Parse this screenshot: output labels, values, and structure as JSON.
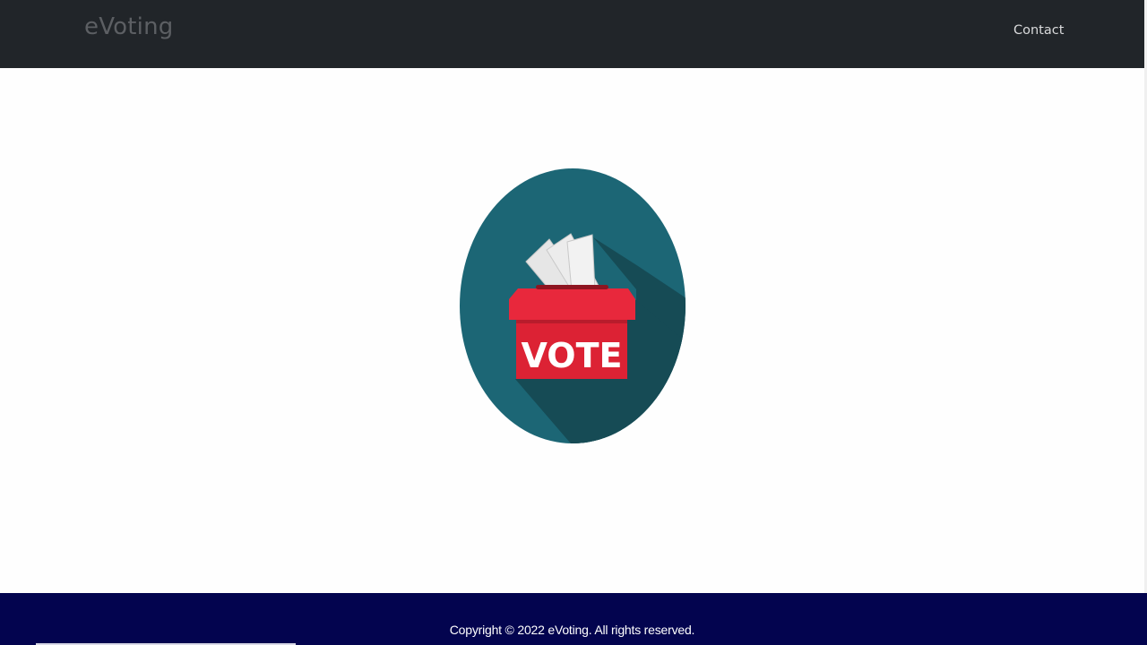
{
  "navbar": {
    "brand": "eVoting",
    "links": [
      {
        "label": "Contact"
      }
    ]
  },
  "hero": {
    "image_icon": "ballot-box-vote-icon",
    "box_label": "VOTE"
  },
  "footer": {
    "copyright": "Copyright © 2022 eVoting. All rights reserved."
  },
  "colors": {
    "navbar_bg": "#212529",
    "footer_bg": "#03044f",
    "circle": "#1c6675",
    "circle_shadow": "#164b55",
    "box_red": "#e8283c",
    "box_dark_red": "#b81c2c"
  }
}
